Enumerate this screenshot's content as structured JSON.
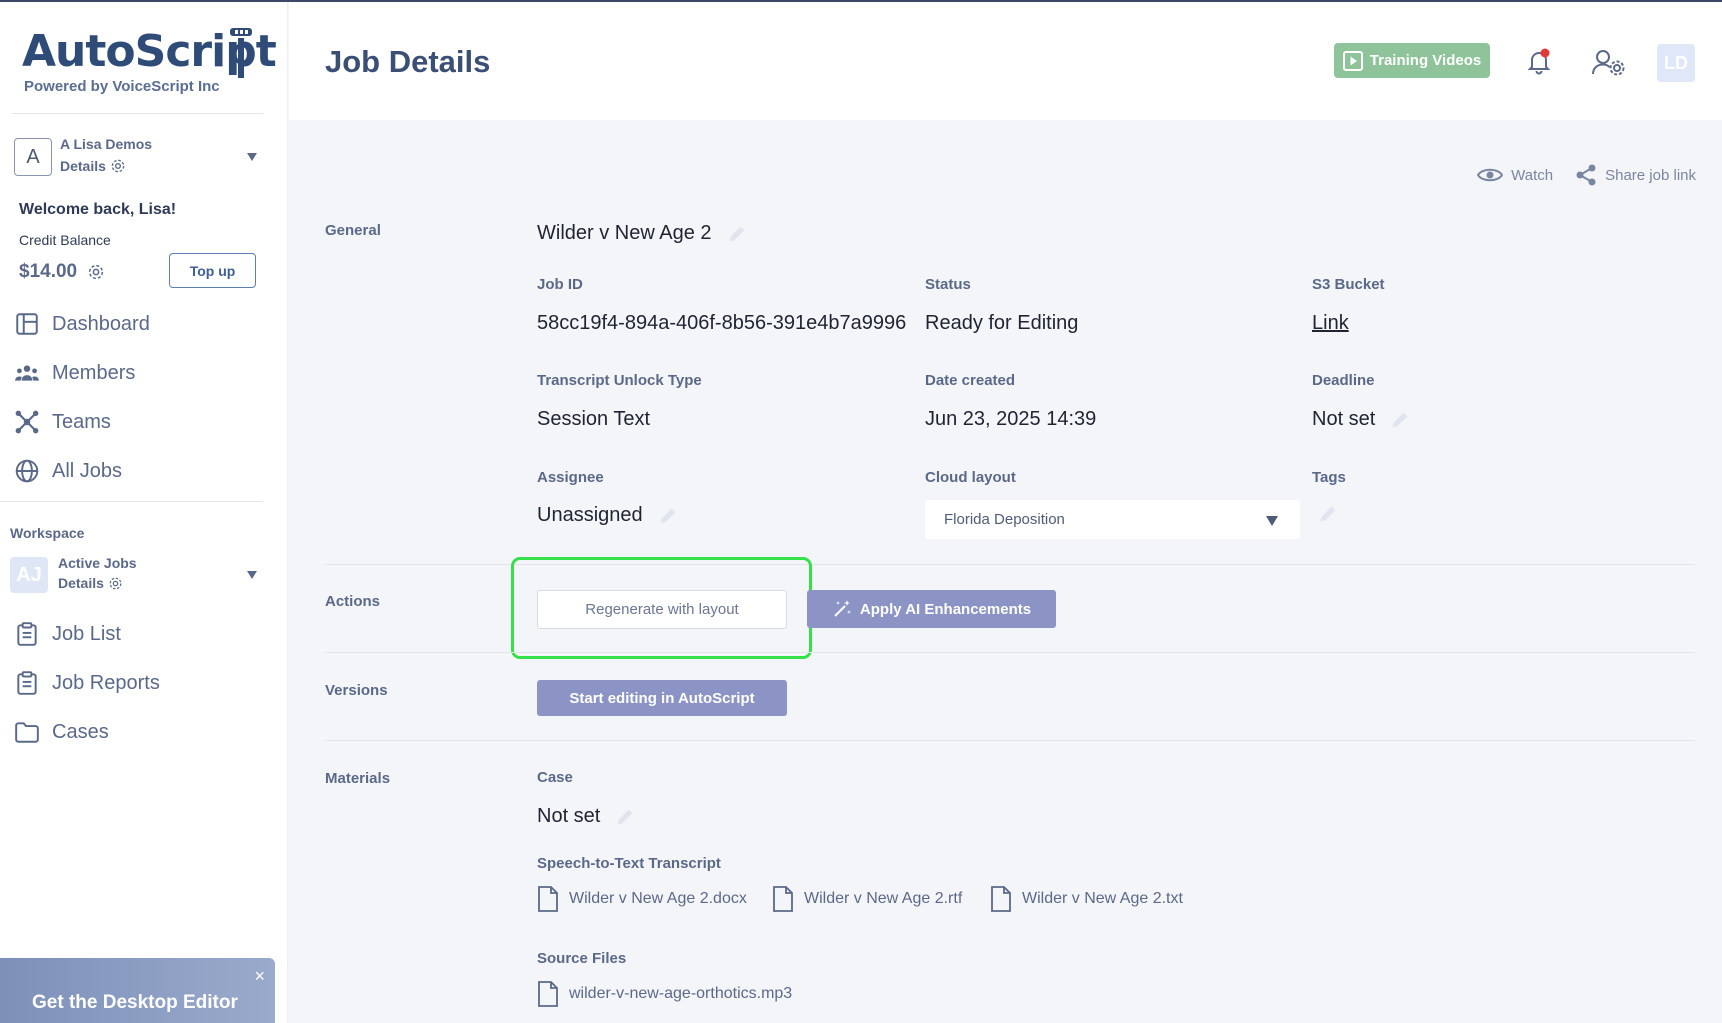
{
  "brand": {
    "name": "AutoScript",
    "tagline": "Powered by VoiceScript Inc"
  },
  "org": {
    "badge": "A",
    "name": "A Lisa Demos",
    "details": "Details"
  },
  "user": {
    "welcome": "Welcome back, Lisa!",
    "credit_label": "Credit Balance",
    "credit_value": "$14.00",
    "topup_label": "Top up"
  },
  "nav": [
    {
      "label": "Dashboard",
      "icon": "dashboard-icon"
    },
    {
      "label": "Members",
      "icon": "members-icon"
    },
    {
      "label": "Teams",
      "icon": "teams-icon"
    },
    {
      "label": "All Jobs",
      "icon": "globe-icon"
    }
  ],
  "workspace": {
    "label": "Workspace",
    "badge": "AJ",
    "name": "Active Jobs",
    "details": "Details",
    "nav": [
      {
        "label": "Job List",
        "icon": "clipboard-icon"
      },
      {
        "label": "Job Reports",
        "icon": "clipboard-icon"
      },
      {
        "label": "Cases",
        "icon": "folder-icon"
      }
    ]
  },
  "promo": {
    "title": "Get the Desktop Editor",
    "close": "×"
  },
  "header": {
    "title": "Job Details",
    "training_label": "Training Videos",
    "avatar": "LD"
  },
  "top_actions": {
    "watch": "Watch",
    "share": "Share job link"
  },
  "general": {
    "section": "General",
    "job_name": "Wilder v New Age 2",
    "job_id_label": "Job ID",
    "job_id": "58cc19f4-894a-406f-8b56-391e4b7a9996",
    "status_label": "Status",
    "status": "Ready for Editing",
    "s3_label": "S3 Bucket",
    "s3_link": "Link",
    "unlock_label": "Transcript Unlock Type",
    "unlock": "Session Text",
    "date_label": "Date created",
    "date": "Jun 23, 2025 14:39",
    "deadline_label": "Deadline",
    "deadline": "Not set",
    "assignee_label": "Assignee",
    "assignee": "Unassigned",
    "cloud_label": "Cloud layout",
    "cloud_value": "Florida Deposition",
    "tags_label": "Tags"
  },
  "actions": {
    "section": "Actions",
    "regenerate": "Regenerate with layout",
    "ai": "Apply AI Enhancements"
  },
  "versions": {
    "section": "Versions",
    "start_editing": "Start editing in AutoScript"
  },
  "materials": {
    "section": "Materials",
    "case_label": "Case",
    "case_value": "Not set",
    "stt_label": "Speech-to-Text Transcript",
    "stt_files": [
      "Wilder v New Age 2.docx",
      "Wilder v New Age 2.rtf",
      "Wilder v New Age 2.txt"
    ],
    "source_label": "Source Files",
    "source_files": [
      "wilder-v-new-age-orthotics.mp3"
    ]
  },
  "colors": {
    "accent": "#2f4b78",
    "green_button": "#8fc49a",
    "purple_button": "#8b94c4",
    "highlight": "#35e04a"
  }
}
